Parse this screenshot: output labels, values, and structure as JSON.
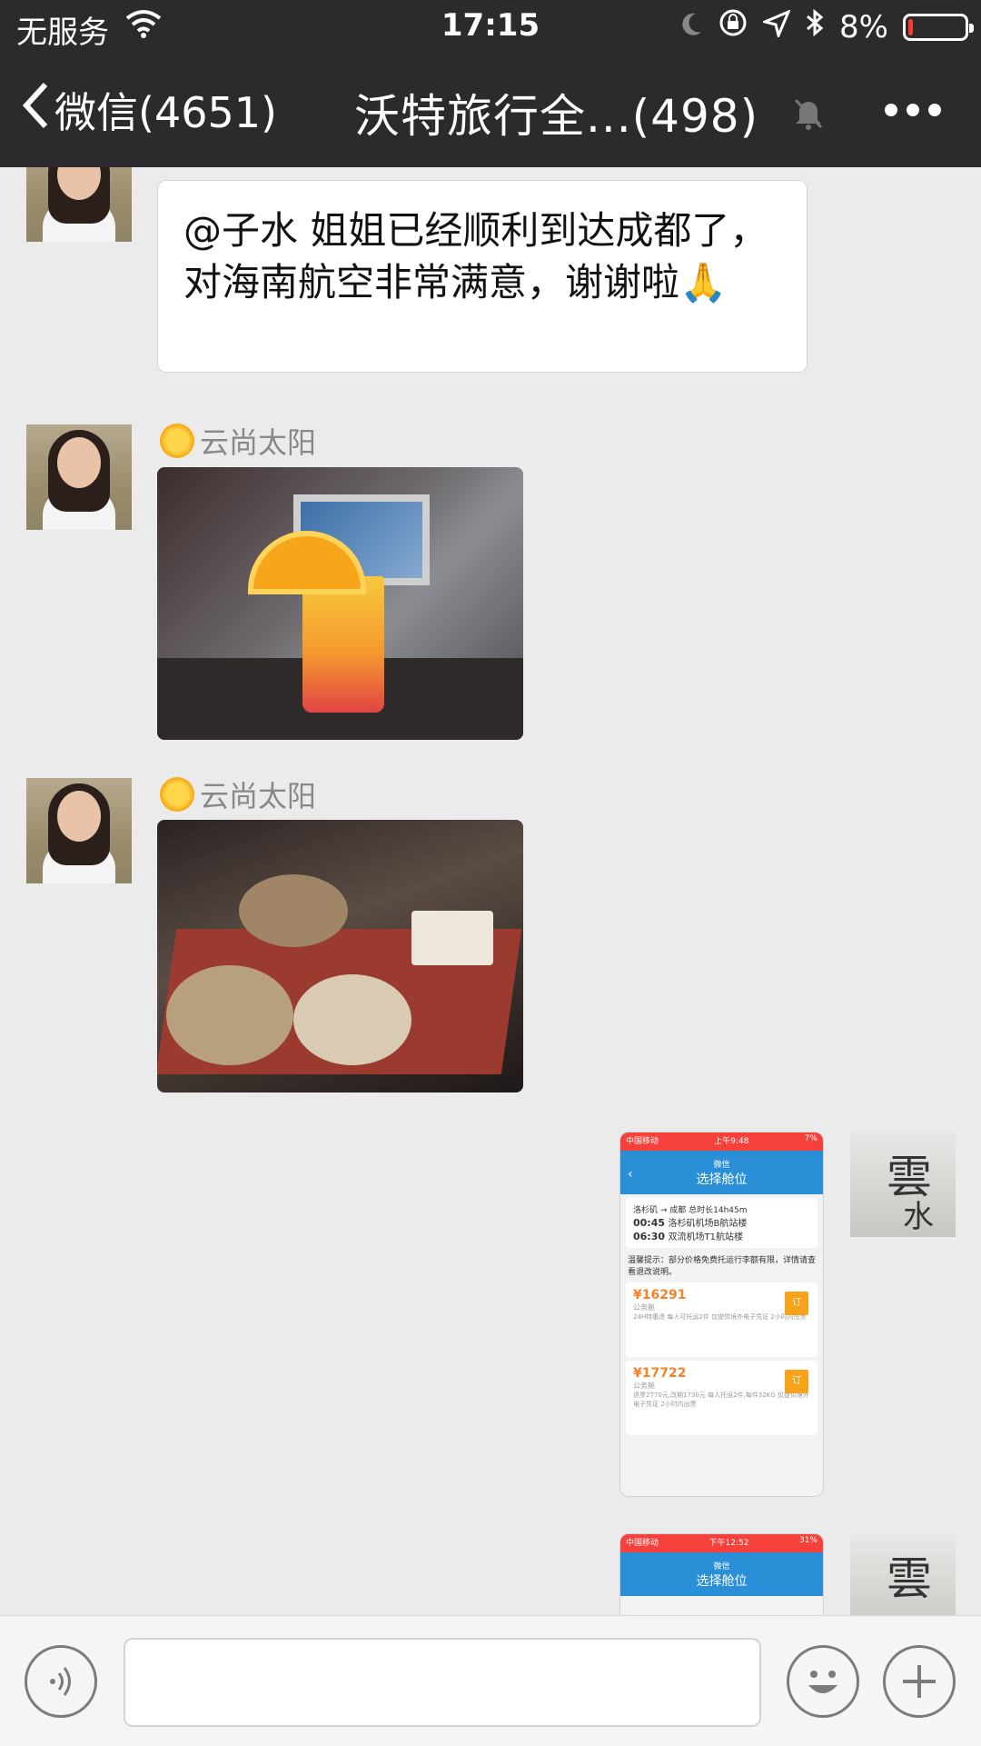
{
  "status_bar": {
    "carrier": "无服务",
    "time": "17:15",
    "battery": "8%",
    "battery_level": 0.08
  },
  "nav": {
    "back_label": "微信(4651)",
    "title": "沃特旅行全...(498)"
  },
  "messages": [
    {
      "type": "text",
      "text": "@子水 姐姐已经顺利到达成都了，对海南航空非常满意，谢谢啦🙏"
    },
    {
      "type": "image",
      "sender": "云尚太阳"
    },
    {
      "type": "image",
      "sender": "云尚太阳"
    },
    {
      "type": "screenshot",
      "outgoing": true,
      "ss": {
        "carrier": "中国移动",
        "time": "上午9:48",
        "app": "微信",
        "title": "选择舱位",
        "route": "洛杉矶 → 成都  总时长14h45m",
        "dep_time": "00:45",
        "dep_airport": "洛杉矶机场B航站楼",
        "arr_time": "06:30",
        "arr_airport": "双流机场T1航站楼",
        "notice": "温馨提示：部分价格免费托运行李额有限，详情请查看退改说明。",
        "price1": "¥16291",
        "class1": "公务舱",
        "desc1": "24H特惠退  每人可托运2件  仅提供境外电子凭证  2小时内出票",
        "price2": "¥17722",
        "class2": "公务舱",
        "desc2": "退票2770元,改期1730元  每人托运2件,每件32KG  仅提供境外电子凭证  2小时内出票",
        "book": "订"
      }
    },
    {
      "type": "screenshot",
      "outgoing": true,
      "ss": {
        "carrier": "中国移动",
        "time": "下午12:52",
        "app": "微信",
        "title": "选择舱位"
      }
    }
  ],
  "my_avatar": {
    "char1": "雲",
    "char2": "水"
  },
  "input": {
    "placeholder": ""
  }
}
